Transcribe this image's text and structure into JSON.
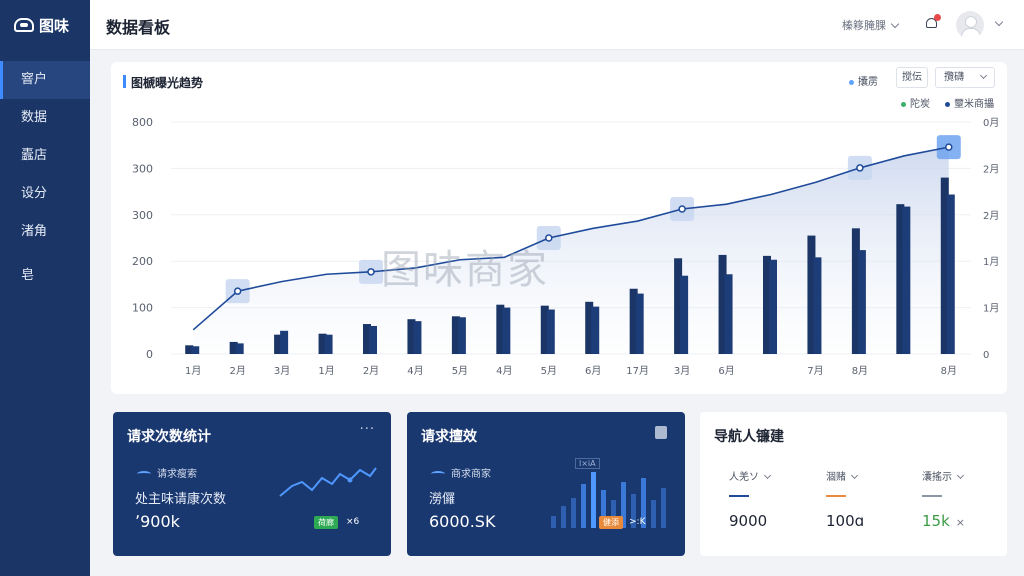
{
  "app": {
    "logo_text": "图味",
    "page_title": "数据看板"
  },
  "sidebar": {
    "items": [
      {
        "label": "窨户",
        "active": true
      },
      {
        "label": "数据"
      },
      {
        "label": "蠹店"
      },
      {
        "label": "设分"
      },
      {
        "label": "渚角"
      },
      {
        "label": "皂"
      }
    ]
  },
  "header": {
    "user_menu_label": "榛簃腌腂",
    "avatar_icon": "user-avatar-icon",
    "bell_icon": "bell-icon"
  },
  "chart_panel": {
    "title": "图榹曝光趋势",
    "legend_top": "攮雳",
    "button_label": "搅伝",
    "select_label": "攬礴",
    "legend_a": "陀炭",
    "legend_b": "壐米商攂",
    "watermark": "图味商家"
  },
  "chart_data": {
    "type": "bar",
    "categories": [
      "1月",
      "2月",
      "3月",
      "1月",
      "2月",
      "4月",
      "5月",
      "4月",
      "5月",
      "6月",
      "17月",
      "3月",
      "6月",
      "",
      "7月",
      "8月",
      "",
      "8月"
    ],
    "series": [
      {
        "name": "陀炭",
        "type": "bar",
        "color": "#1a3566",
        "values": [
          [
            18,
            16
          ],
          [
            25,
            22
          ],
          [
            40,
            48
          ],
          [
            42,
            40
          ],
          [
            62,
            58
          ],
          [
            72,
            68
          ],
          [
            78,
            76
          ],
          [
            102,
            96
          ],
          [
            100,
            92
          ],
          [
            108,
            98
          ],
          [
            135,
            125
          ],
          [
            198,
            162
          ],
          [
            205,
            165
          ],
          [
            203,
            195
          ],
          [
            245,
            200
          ],
          [
            260,
            215
          ],
          [
            310,
            305
          ],
          [
            365,
            330
          ]
        ]
      },
      {
        "name": "壐米商攂",
        "type": "line",
        "color": "#1f4b9a",
        "values": [
          50,
          130,
          150,
          165,
          170,
          178,
          195,
          200,
          240,
          260,
          275,
          300,
          310,
          330,
          355,
          385,
          410,
          428
        ]
      }
    ],
    "y_left_ticks": [
      "0",
      "100",
      "200",
      "300",
      "300",
      "800"
    ],
    "y_right_ticks": [
      "0",
      "1月",
      "1月",
      "2月",
      "2月",
      "0月"
    ],
    "ylim": [
      0,
      480
    ],
    "highlights": [
      2,
      5,
      9,
      12,
      16,
      18
    ],
    "legend_placement": "top-right",
    "grid": true
  },
  "cards": {
    "c1": {
      "title": "请求次数统计",
      "more": "···",
      "legend": "请求瘦索",
      "subtitle": "处主味请康次数",
      "value": "900k",
      "value_prefix_glyph": "ʼ",
      "badge": "荷廊",
      "trend": "×6"
    },
    "c2": {
      "title": "请求擅效",
      "legend": "商求商家",
      "subtitle": "澇儸",
      "value": "6000.SK",
      "badge": "健添",
      "trend": ">:K",
      "spark_label": "l×iA"
    },
    "c3": {
      "title": "导航人镰建",
      "metrics": [
        {
          "label": "人羌ソ",
          "value": "9000",
          "color": "#1f4b9a"
        },
        {
          "label": "涸赌",
          "value": "100ɑ",
          "color": "#e88a3a"
        },
        {
          "label": "灢搖示",
          "value": "15k",
          "suffix": "×",
          "color": "#3b9b44"
        }
      ]
    }
  }
}
